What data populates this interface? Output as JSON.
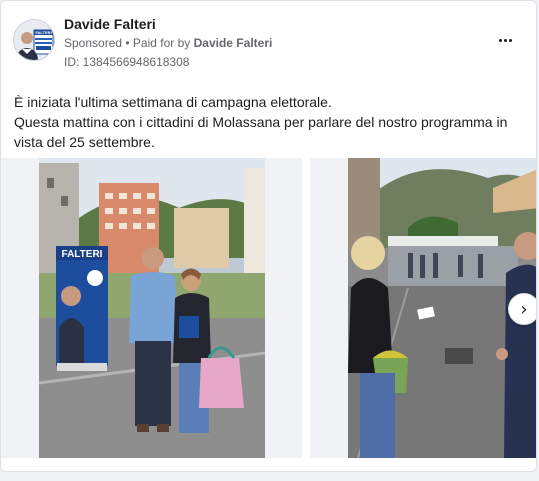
{
  "post": {
    "page_name": "Davide Falteri",
    "sponsored_label": "Sponsored",
    "meta_separator": " • ",
    "paid_for_prefix": "Paid for by ",
    "paid_for_name": "Davide Falteri",
    "ad_id": "ID: 1384566948618308",
    "text_line1": "È iniziata l'ultima settimana di campagna elettorale.",
    "text_line2": "Questa mattina con i cittadini di Molassana per parlare del nostro programma in vista del 25 settembre."
  },
  "images": {
    "banner_text": "FALTERI",
    "avatar_banner_text": "FALTERI"
  },
  "icons": {
    "more": "more-horizontal-icon",
    "next": "chevron-right-icon"
  },
  "colors": {
    "text_primary": "#1c1e21",
    "text_secondary": "#65676b",
    "card_border": "#dddfe2",
    "banner_blue": "#1d4e9e"
  }
}
